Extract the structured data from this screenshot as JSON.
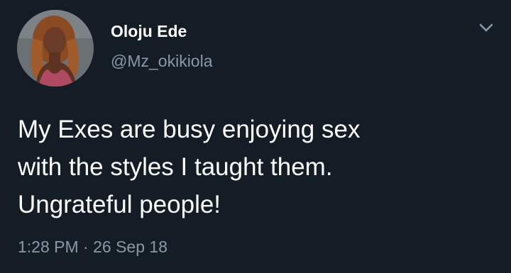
{
  "author": {
    "name": "Oloju Ede",
    "handle": "@Mz_okikiola",
    "avatar_icon": "profile-photo"
  },
  "tweet": {
    "lines": [
      "My Exes are busy enjoying sex",
      "with the styles I taught them.",
      "Ungrateful people!"
    ],
    "time": "1:28 PM",
    "separator": "·",
    "date": "26 Sep 18"
  },
  "menu": {
    "icon": "chevron-down-icon"
  },
  "colors": {
    "background": "#141d26",
    "primary_text": "#ffffff",
    "secondary_text": "#8899a6"
  }
}
